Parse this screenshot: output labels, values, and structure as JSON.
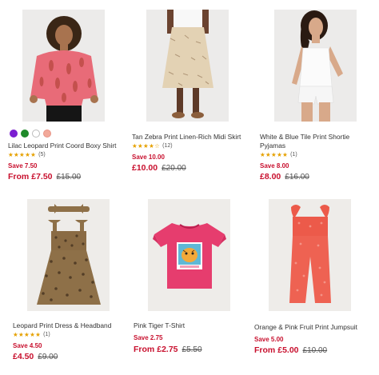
{
  "products": [
    {
      "title": "Lilac Leopard Print Coord Boxy Shirt",
      "stars": "★★★★★",
      "review_count": "(5)",
      "save": "Save 7.50",
      "price_prefix": "From",
      "price_now": "£7.50",
      "price_was": "£15.00",
      "swatches": [
        "#7b1fd1",
        "#1f8a2a",
        "#ffffff",
        "#f2a99a"
      ]
    },
    {
      "title": "Tan Zebra Print Linen-Rich Midi Skirt",
      "stars": "★★★★☆",
      "review_count": "(12)",
      "save": "Save 10.00",
      "price_now": "£10.00",
      "price_was": "£20.00"
    },
    {
      "title": "White & Blue Tile Print Shortie Pyjamas",
      "stars": "★★★★★",
      "review_count": "(1)",
      "save": "Save 8.00",
      "price_now": "£8.00",
      "price_was": "£16.00"
    },
    {
      "title": "Leopard Print Dress & Headband",
      "stars": "★★★★★",
      "review_count": "(1)",
      "save": "Save 4.50",
      "price_now": "£4.50",
      "price_was": "£9.00"
    },
    {
      "title": "Pink Tiger T-Shirt",
      "save": "Save 2.75",
      "price_prefix": "From",
      "price_now": "£2.75",
      "price_was": "£5.50"
    },
    {
      "title": "Orange & Pink Fruit Print Jumpsuit",
      "save": "Save 5.00",
      "price_prefix": "From",
      "price_now": "£5.00",
      "price_was": "£10.00"
    }
  ],
  "colors": {
    "sale_red": "#c8102e",
    "star_gold": "#e6a100"
  },
  "images": [
    "pink-giraffe-shirt-photo",
    "zebra-skirt-photo",
    "white-pyjamas-photo",
    "leopard-dress-photo",
    "pink-tiger-tshirt-photo",
    "orange-jumpsuit-photo"
  ]
}
